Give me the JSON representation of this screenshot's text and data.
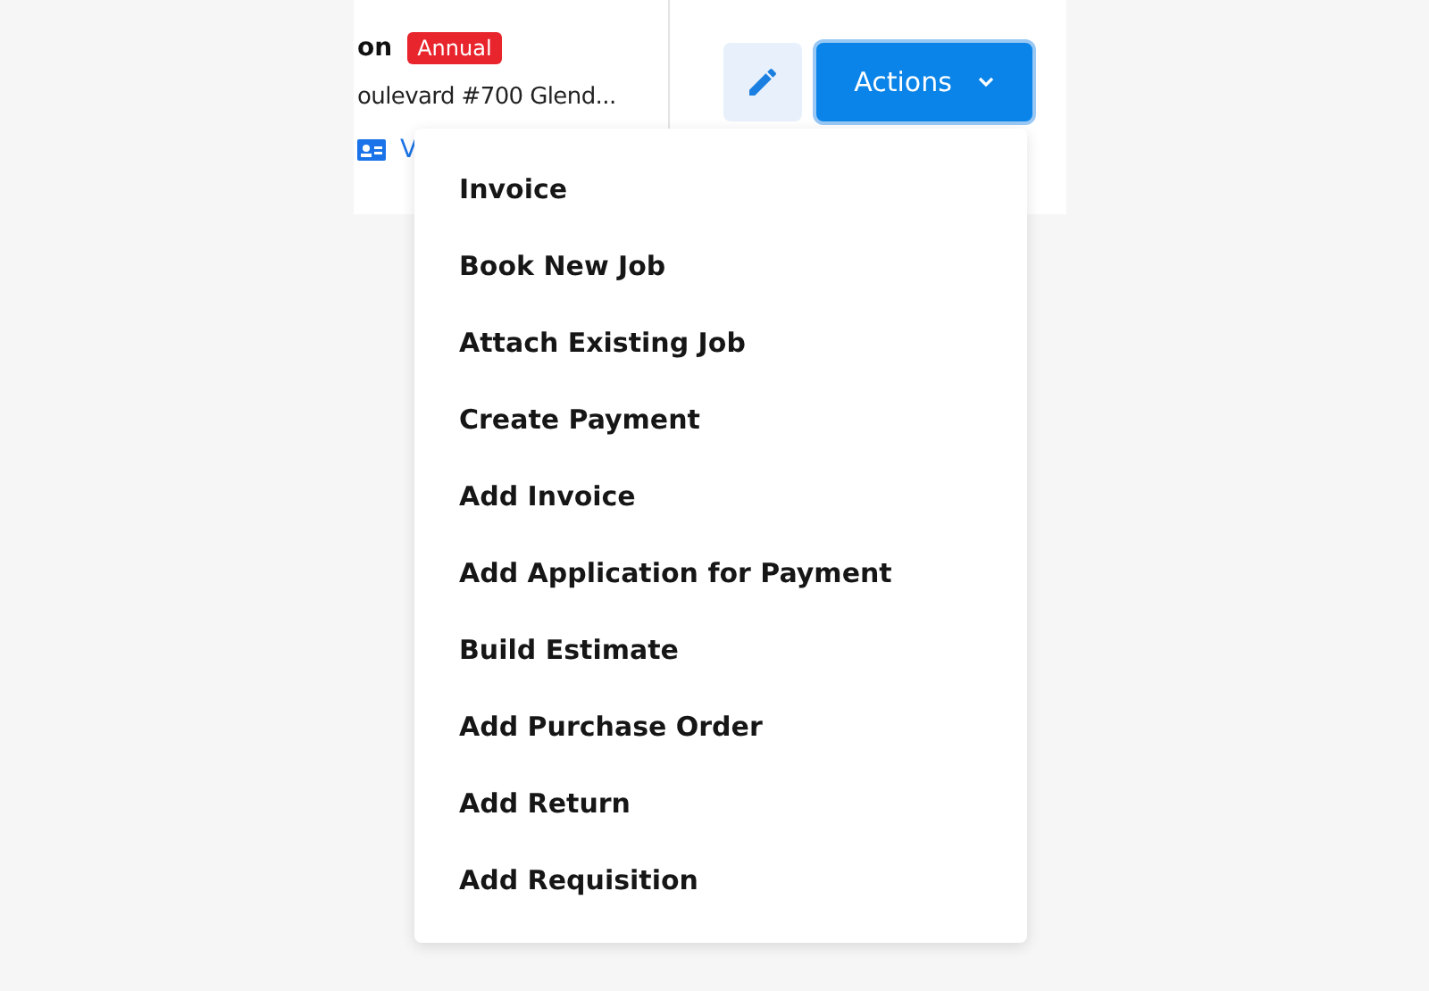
{
  "header": {
    "title": "on",
    "badge": "Annual",
    "address": "oulevard #700 Glend...",
    "link": "V"
  },
  "actions": {
    "label": "Actions",
    "expanded": true
  },
  "menu": [
    {
      "label": "Invoice"
    },
    {
      "label": "Book New Job"
    },
    {
      "label": "Attach Existing Job"
    },
    {
      "label": "Create Payment"
    },
    {
      "label": "Add Invoice"
    },
    {
      "label": "Add Application for Payment"
    },
    {
      "label": "Build Estimate"
    },
    {
      "label": "Add Purchase Order"
    },
    {
      "label": "Add Return"
    },
    {
      "label": "Add Requisition"
    }
  ]
}
